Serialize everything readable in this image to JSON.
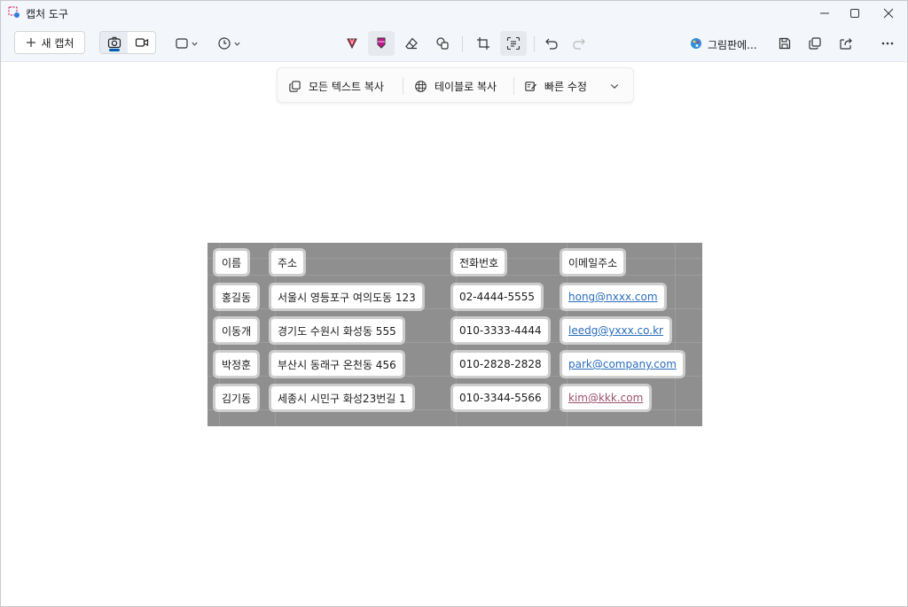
{
  "window": {
    "title": "캡처 도구"
  },
  "toolbar": {
    "new_capture": "새 캡처",
    "paint_label": "그림판에..."
  },
  "textbar": {
    "copy_all": "모든 텍스트 복사",
    "copy_table": "테이블로 복사",
    "quick_edit": "빠른 수정"
  },
  "table": {
    "headers": [
      "이름",
      "주소",
      "전화번호",
      "이메일주소"
    ],
    "rows": [
      [
        "홍길동",
        "서울시 영등포구 여의도동 123",
        "02-4444-5555",
        "hong@nxxx.com"
      ],
      [
        "이동개",
        "경기도 수원시 화성동 555",
        "010-3333-4444",
        "leedg@yxxx.co.kr"
      ],
      [
        "박정훈",
        "부산시 동래구 온천동 456",
        "010-2828-2828",
        "park@company.com"
      ],
      [
        "김기동",
        "세종시 시민구 화성23번길 1",
        "010-3344-5566",
        "kim@kkk.com"
      ]
    ]
  },
  "colors": {
    "accent": "#005fb8",
    "link": "#2a6ebb",
    "visited_link": "#9c4f6c",
    "capture_bg": "#8f8f8f"
  }
}
